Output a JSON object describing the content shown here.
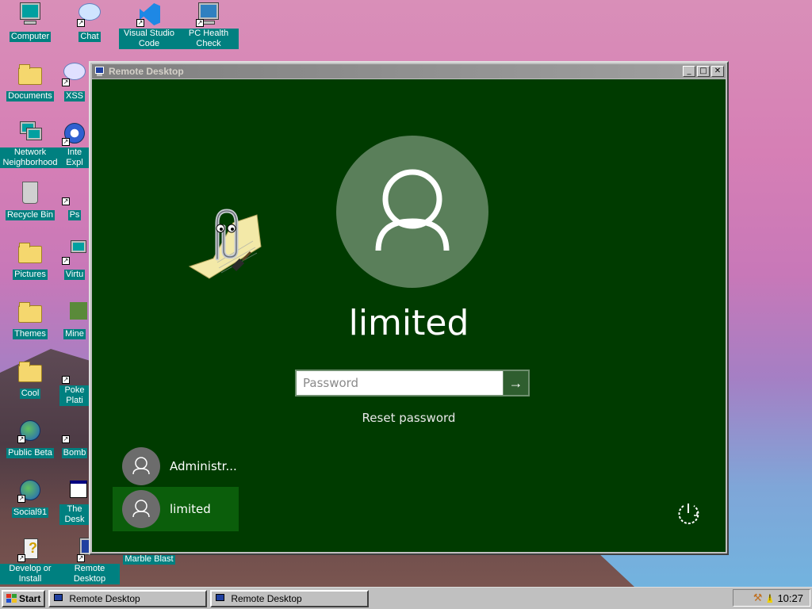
{
  "desktop": {
    "icons": [
      {
        "label": "Computer"
      },
      {
        "label": "Chat"
      },
      {
        "label": "Visual Studio Code"
      },
      {
        "label": "PC Health Check"
      },
      {
        "label": "Documents"
      },
      {
        "label": "XSS"
      },
      {
        "label": "Network Neighborhood"
      },
      {
        "label": "Inte Expl"
      },
      {
        "label": "Recycle Bin"
      },
      {
        "label": "Ps"
      },
      {
        "label": "Pictures"
      },
      {
        "label": "Virtu"
      },
      {
        "label": "Themes"
      },
      {
        "label": "Mine"
      },
      {
        "label": "Cool"
      },
      {
        "label": "Poke Plati"
      },
      {
        "label": "Public Beta"
      },
      {
        "label": "Bomb"
      },
      {
        "label": "Social91"
      },
      {
        "label": "The Desk"
      },
      {
        "label": "Develop or Install"
      },
      {
        "label": "Remote Desktop"
      },
      {
        "label": "Marble Blast"
      }
    ]
  },
  "window": {
    "title": "Remote Desktop",
    "controls": {
      "minimize": "_",
      "maximize": "□",
      "close": "✕"
    }
  },
  "login": {
    "username": "limited",
    "password_placeholder": "Password",
    "submit_glyph": "→",
    "reset_link": "Reset password",
    "users": [
      {
        "name": "Administr...",
        "selected": false
      },
      {
        "name": "limited",
        "selected": true
      }
    ]
  },
  "taskbar": {
    "start_label": "Start",
    "tasks": [
      "Remote Desktop",
      "Remote Desktop"
    ],
    "clock": "10:27"
  },
  "colors": {
    "login_bg": "#003b00",
    "selected_tile": "#0b5e0b",
    "teal_label": "#008080"
  }
}
